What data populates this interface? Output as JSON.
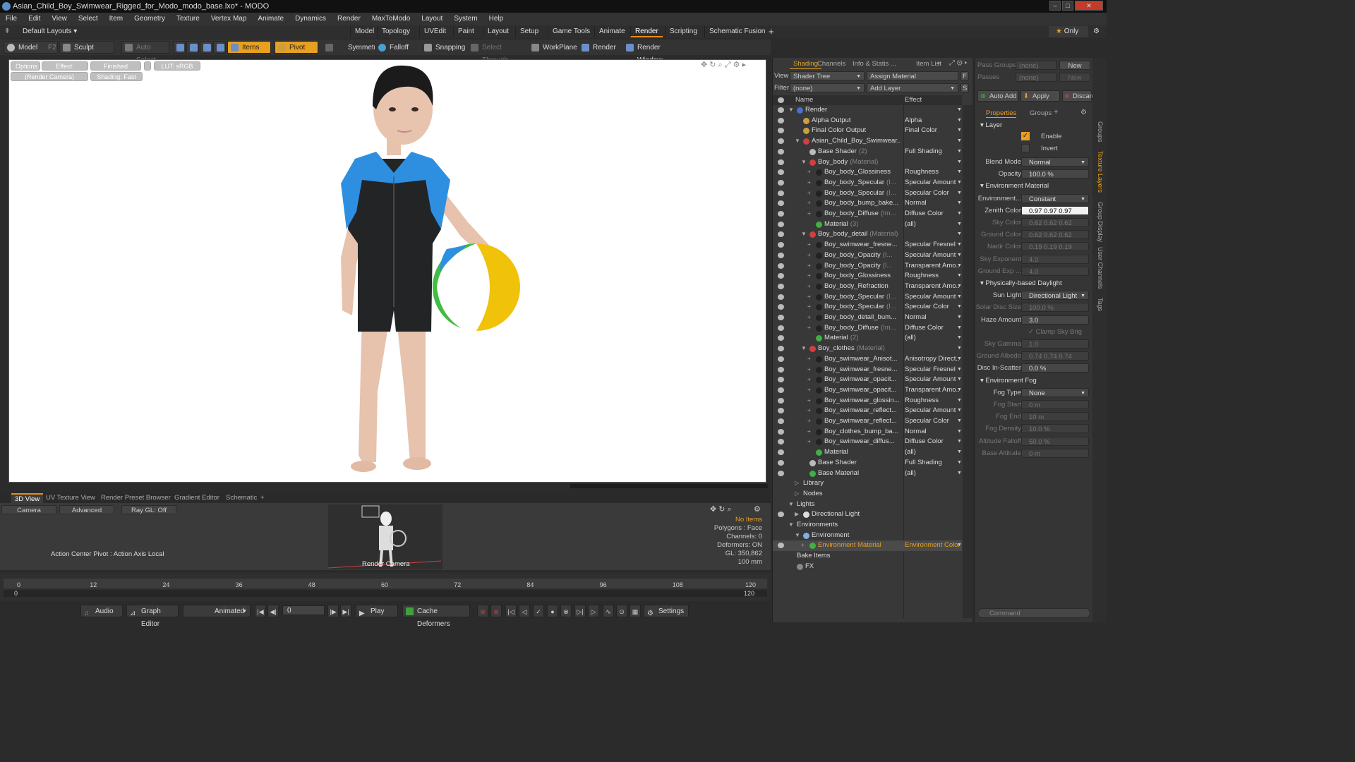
{
  "window": {
    "title": "Asian_Child_Boy_Swimwear_Rigged_for_Modo_modo_base.lxo* - MODO"
  },
  "menu": [
    "File",
    "Edit",
    "View",
    "Select",
    "Item",
    "Geometry",
    "Texture",
    "Vertex Map",
    "Animate",
    "Dynamics",
    "Render",
    "MaxToModo",
    "Layout",
    "System",
    "Help"
  ],
  "layouts": {
    "label": "Default Layouts",
    "tabs": [
      "Model",
      "Topology",
      "UVEdit",
      "Paint",
      "Layout",
      "Setup",
      "Game Tools",
      "Animate",
      "Render",
      "Scripting",
      "Schematic Fusion"
    ],
    "active": "Render",
    "only": "Only"
  },
  "toolbar": {
    "model": "Model",
    "model_key": "F2",
    "sculpt": "Sculpt",
    "auto_select": "Auto Select",
    "items": "Items",
    "pivot": "Pivot",
    "symmetry": "Symmetry",
    "falloff": "Falloff",
    "snapping": "Snapping",
    "select_through": "Select Through",
    "workplane": "WorkPlane",
    "render": "Render",
    "render_window": "Render Window"
  },
  "viewport": {
    "options": "Options",
    "effect": "Effect: (Shadi...",
    "finished": "Finished",
    "lut": "LUT: sRGB",
    "camera": "(Render Camera)",
    "shading": "Shading: Fast"
  },
  "bottom_tabs": [
    "3D View",
    "UV Texture View",
    "Render Preset Browser",
    "Gradient Editor",
    "Schematic"
  ],
  "lower_view": {
    "camera": "Camera",
    "advanced": "Advanced",
    "raygl": "Ray GL: Off",
    "action_center": "Action Center Pivot : Action Axis Local",
    "render_camera": "Render Camera",
    "info": [
      "No Items",
      "Polygons : Face",
      "Channels: 0",
      "Deformers: ON",
      "GL: 350,862",
      "100 mm"
    ]
  },
  "timeline": {
    "ticks": [
      "0",
      "12",
      "24",
      "36",
      "48",
      "60",
      "72",
      "84",
      "96",
      "108",
      "120"
    ],
    "sub_ticks": [
      "0",
      "120"
    ]
  },
  "transport": {
    "audio": "Audio",
    "graph_editor": "Graph Editor",
    "animated": "Animated",
    "frame": "0",
    "play": "Play",
    "cache": "Cache Deformers",
    "settings": "Settings"
  },
  "shading": {
    "tabs": [
      "Shading",
      "Channels",
      "Info & Statis ...",
      "Item List"
    ],
    "view_label": "View",
    "view_value": "Shader Tree",
    "assign": "Assign Material",
    "f_btn": "F",
    "filter_label": "Filter",
    "filter_value": "(none)",
    "add_layer": "Add Layer",
    "s_btn": "S",
    "col_name": "Name",
    "col_effect": "Effect",
    "rows": [
      {
        "indent": 0,
        "name": "Render",
        "sub": "",
        "effect": "",
        "ball": "#4a6fd0",
        "exp": "▼"
      },
      {
        "indent": 1,
        "name": "Alpha Output",
        "sub": "",
        "effect": "Alpha",
        "ball": "#c8a040",
        "exp": ""
      },
      {
        "indent": 1,
        "name": "Final Color Output",
        "sub": "",
        "effect": "Final Color",
        "ball": "#c8a040",
        "exp": ""
      },
      {
        "indent": 1,
        "name": "Asian_Child_Boy_Swimwear...",
        "sub": "",
        "effect": "",
        "ball": "#d04040",
        "exp": "▼"
      },
      {
        "indent": 2,
        "name": "Base Shader",
        "sub": "(2)",
        "effect": "Full Shading",
        "ball": "#bbbbbb",
        "exp": ""
      },
      {
        "indent": 2,
        "name": "Boy_body",
        "sub": "(Material)",
        "effect": "",
        "ball": "#d04040",
        "exp": "▼"
      },
      {
        "indent": 3,
        "name": "Boy_body_Glossiness",
        "sub": "",
        "effect": "Roughness",
        "ball": "#222222",
        "exp": "+"
      },
      {
        "indent": 3,
        "name": "Boy_body_Specular",
        "sub": "(I...",
        "effect": "Specular Amount",
        "ball": "#222222",
        "exp": "+"
      },
      {
        "indent": 3,
        "name": "Boy_body_Specular",
        "sub": "(I...",
        "effect": "Specular Color",
        "ball": "#222222",
        "exp": "+"
      },
      {
        "indent": 3,
        "name": "Boy_body_bump_bake...",
        "sub": "",
        "effect": "Normal",
        "ball": "#222222",
        "exp": "+"
      },
      {
        "indent": 3,
        "name": "Boy_body_Diffuse",
        "sub": "(Im...",
        "effect": "Diffuse Color",
        "ball": "#222222",
        "exp": "+"
      },
      {
        "indent": 3,
        "name": "Material",
        "sub": "(3)",
        "effect": "(all)",
        "ball": "#40b040",
        "exp": ""
      },
      {
        "indent": 2,
        "name": "Boy_body_detail",
        "sub": "(Material)",
        "effect": "",
        "ball": "#d04040",
        "exp": "▼"
      },
      {
        "indent": 3,
        "name": "Boy_swimwear_fresne...",
        "sub": "",
        "effect": "Specular Fresnel",
        "ball": "#222222",
        "exp": "+"
      },
      {
        "indent": 3,
        "name": "Boy_body_Opacity",
        "sub": "(I...",
        "effect": "Specular Amount",
        "ball": "#222222",
        "exp": "+"
      },
      {
        "indent": 3,
        "name": "Boy_body_Opacity",
        "sub": "(I...",
        "effect": "Transparent Amo...",
        "ball": "#222222",
        "exp": "+"
      },
      {
        "indent": 3,
        "name": "Boy_body_Glossiness",
        "sub": "",
        "effect": "Roughness",
        "ball": "#222222",
        "exp": "+"
      },
      {
        "indent": 3,
        "name": "Boy_body_Refraction",
        "sub": "",
        "effect": "Transparent Amo...",
        "ball": "#222222",
        "exp": "+"
      },
      {
        "indent": 3,
        "name": "Boy_body_Specular",
        "sub": "(I...",
        "effect": "Specular Amount",
        "ball": "#222222",
        "exp": "+"
      },
      {
        "indent": 3,
        "name": "Boy_body_Specular",
        "sub": "(I...",
        "effect": "Specular Color",
        "ball": "#222222",
        "exp": "+"
      },
      {
        "indent": 3,
        "name": "Boy_body_detail_bum...",
        "sub": "",
        "effect": "Normal",
        "ball": "#222222",
        "exp": "+"
      },
      {
        "indent": 3,
        "name": "Boy_body_Diffuse",
        "sub": "(Im...",
        "effect": "Diffuse Color",
        "ball": "#222222",
        "exp": "+"
      },
      {
        "indent": 3,
        "name": "Material",
        "sub": "(2)",
        "effect": "(all)",
        "ball": "#40b040",
        "exp": ""
      },
      {
        "indent": 2,
        "name": "Boy_clothes",
        "sub": "(Material)",
        "effect": "",
        "ball": "#d04040",
        "exp": "▼"
      },
      {
        "indent": 3,
        "name": "Boy_swimwear_Anisot...",
        "sub": "",
        "effect": "Anisotropy Direct...",
        "ball": "#222222",
        "exp": "+"
      },
      {
        "indent": 3,
        "name": "Boy_swimwear_fresne...",
        "sub": "",
        "effect": "Specular Fresnel",
        "ball": "#222222",
        "exp": "+"
      },
      {
        "indent": 3,
        "name": "Boy_swimwear_opacit...",
        "sub": "",
        "effect": "Specular Amount",
        "ball": "#222222",
        "exp": "+"
      },
      {
        "indent": 3,
        "name": "Boy_swimwear_opacit...",
        "sub": "",
        "effect": "Transparent Amo...",
        "ball": "#222222",
        "exp": "+"
      },
      {
        "indent": 3,
        "name": "Boy_swimwear_glossin...",
        "sub": "",
        "effect": "Roughness",
        "ball": "#222222",
        "exp": "+"
      },
      {
        "indent": 3,
        "name": "Boy_swimwear_reflect...",
        "sub": "",
        "effect": "Specular Amount",
        "ball": "#222222",
        "exp": "+"
      },
      {
        "indent": 3,
        "name": "Boy_swimwear_reflect...",
        "sub": "",
        "effect": "Specular Color",
        "ball": "#222222",
        "exp": "+"
      },
      {
        "indent": 3,
        "name": "Boy_clothes_bump_ba...",
        "sub": "",
        "effect": "Normal",
        "ball": "#222222",
        "exp": "+"
      },
      {
        "indent": 3,
        "name": "Boy_swimwear_diffus...",
        "sub": "",
        "effect": "Diffuse Color",
        "ball": "#222222",
        "exp": "+"
      },
      {
        "indent": 3,
        "name": "Material",
        "sub": "",
        "effect": "(all)",
        "ball": "#40b040",
        "exp": ""
      },
      {
        "indent": 2,
        "name": "Base Shader",
        "sub": "",
        "effect": "Full Shading",
        "ball": "#bbbbbb",
        "exp": ""
      },
      {
        "indent": 2,
        "name": "Base Material",
        "sub": "",
        "effect": "(all)",
        "ball": "#40b040",
        "exp": ""
      },
      {
        "indent": 1,
        "name": "Library",
        "sub": "",
        "effect": "",
        "ball": "",
        "exp": "▷",
        "noeye": true
      },
      {
        "indent": 1,
        "name": "Nodes",
        "sub": "",
        "effect": "",
        "ball": "",
        "exp": "▷",
        "noeye": true
      },
      {
        "indent": 0,
        "name": "Lights",
        "sub": "",
        "effect": "",
        "ball": "",
        "exp": "▼",
        "noeye": true
      },
      {
        "indent": 1,
        "name": "Directional Light",
        "sub": "",
        "effect": "",
        "ball": "#dddddd",
        "exp": "▶"
      },
      {
        "indent": 0,
        "name": "Environments",
        "sub": "",
        "effect": "",
        "ball": "",
        "exp": "▼",
        "noeye": true
      },
      {
        "indent": 1,
        "name": "Environment",
        "sub": "",
        "effect": "",
        "ball": "#7fb0e0",
        "exp": "▼",
        "noeye": true
      },
      {
        "indent": 2,
        "name": "Environment Material",
        "sub": "",
        "effect": "Environment Color",
        "ball": "#40b040",
        "exp": "+",
        "selected": true
      },
      {
        "indent": 0,
        "name": "Bake Items",
        "sub": "",
        "effect": "",
        "ball": "",
        "exp": "",
        "noeye": true
      },
      {
        "indent": 0,
        "name": "FX",
        "sub": "",
        "effect": "",
        "ball": "#888888",
        "exp": "",
        "noeye": true
      }
    ]
  },
  "properties": {
    "pass_groups": "Pass Groups",
    "pass_none": "(none)",
    "new": "New",
    "passes": "Passes",
    "passes_none": "(none)",
    "auto_add": "Auto Add",
    "apply": "Apply",
    "discard": "Discard",
    "tab_props": "Properties",
    "tab_groups": "Groups",
    "layer": "Layer",
    "enable": "Enable",
    "invert": "Invert",
    "rows": [
      {
        "label": "Blend Mode",
        "value": "Normal",
        "dim": false,
        "drop": true
      },
      {
        "label": "Opacity",
        "value": "100.0 %",
        "dim": false
      },
      {
        "head": "Environment Material"
      },
      {
        "label": "Environment...",
        "value": "Constant",
        "dim": false,
        "drop": true
      },
      {
        "label": "Zenith Color",
        "value": "0.97  0.97  0.97",
        "dim": false,
        "white": true
      },
      {
        "label": "Sky Color",
        "value": "0.62  0.62  0.62",
        "dim": true
      },
      {
        "label": "Ground Color",
        "value": "0.62  0.62  0.62",
        "dim": true
      },
      {
        "label": "Nadir Color",
        "value": "0.19  0.19  0.19",
        "dim": true
      },
      {
        "label": "Sky Exponent",
        "value": "4.0",
        "dim": true
      },
      {
        "label": "Ground Exp ...",
        "value": "4.0",
        "dim": true
      },
      {
        "head": "Physically-based Daylight"
      },
      {
        "label": "Sun Light",
        "value": "Directional Light",
        "dim": false,
        "drop": true
      },
      {
        "label": "Solar Disc Size",
        "value": "100.0 %",
        "dim": true
      },
      {
        "label": "Haze Amount",
        "value": "3.0",
        "dim": false
      },
      {
        "label": "",
        "value": "Clamp Sky Brig ...",
        "dim": true,
        "check": true
      },
      {
        "label": "Sky Gamma",
        "value": "1.0",
        "dim": true
      },
      {
        "label": "Ground Albedo",
        "value": "0.74  0.74  0.74",
        "dim": true
      },
      {
        "label": "Disc In-Scatter",
        "value": "0.0 %",
        "dim": false
      },
      {
        "head": "Environment Fog"
      },
      {
        "label": "Fog Type",
        "value": "None",
        "dim": false,
        "drop": true
      },
      {
        "label": "Fog Start",
        "value": "0 m",
        "dim": true
      },
      {
        "label": "Fog End",
        "value": "10 m",
        "dim": true
      },
      {
        "label": "Fog Density",
        "value": "10.0 %",
        "dim": true
      },
      {
        "label": "Altitude Falloff",
        "value": "50.0 %",
        "dim": true
      },
      {
        "label": "Base Altitude",
        "value": "0 m",
        "dim": true
      }
    ],
    "command": "Command"
  },
  "side_tabs": [
    "Groups",
    "Texture Layers",
    "Group Display",
    "User Channels",
    "Tags"
  ]
}
